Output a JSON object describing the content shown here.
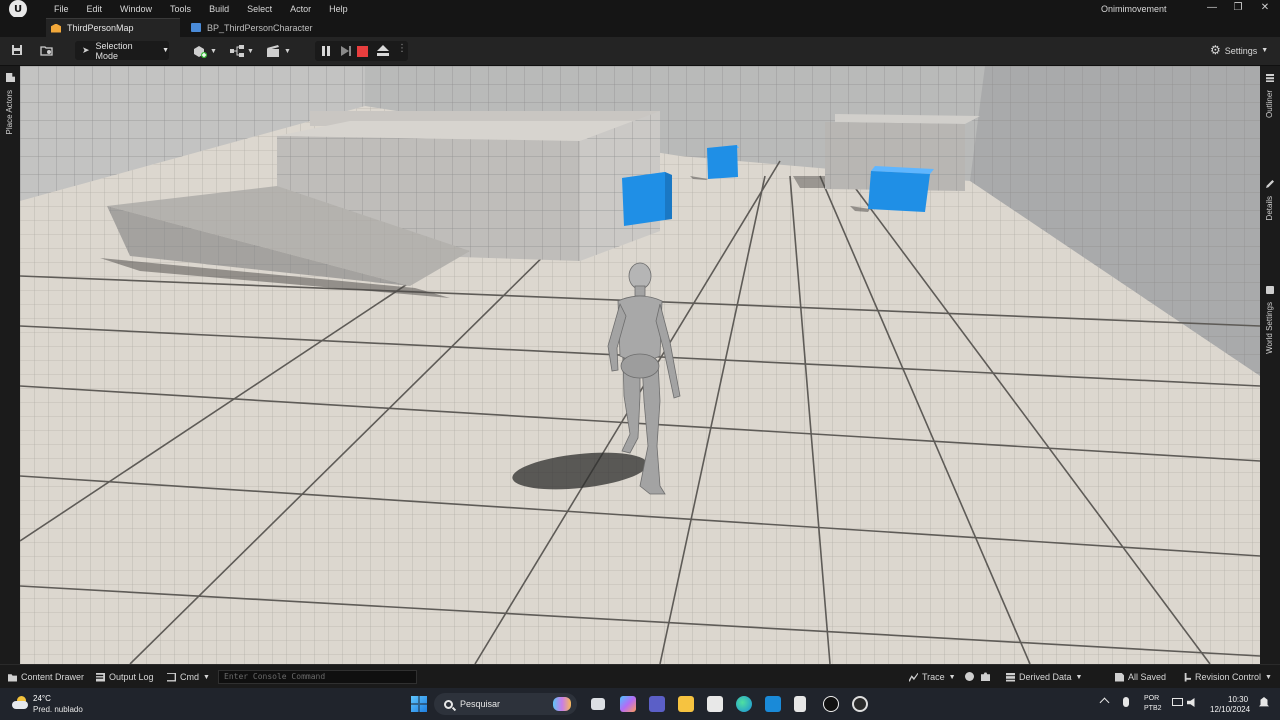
{
  "app": {
    "logo": "U",
    "menu": [
      "File",
      "Edit",
      "Window",
      "Tools",
      "Build",
      "Select",
      "Actor",
      "Help"
    ],
    "project_name": "Onimimovement",
    "window_controls": [
      "—",
      "❐",
      "✕"
    ]
  },
  "tabs": [
    {
      "label": "ThirdPersonMap",
      "active": true,
      "icon": "level-icon"
    },
    {
      "label": "BP_ThirdPersonCharacter",
      "active": false,
      "icon": "blueprint-icon"
    }
  ],
  "toolbar": {
    "selection_mode": "Selection Mode",
    "settings": "Settings",
    "icons": [
      "save-icon",
      "content-browser-icon",
      "add-actor-icon",
      "blueprint-menu-icon",
      "cinematics-icon",
      "pause-icon",
      "step-icon",
      "stop-icon",
      "eject-icon",
      "more-icon",
      "gear-icon"
    ]
  },
  "side_panels": {
    "left": "Place Actors",
    "right": [
      "Outliner",
      "Details",
      "World Settings"
    ]
  },
  "statusbar": {
    "content_drawer": "Content Drawer",
    "output_log": "Output Log",
    "cmd": "Cmd",
    "console_placeholder": "Enter Console Command",
    "trace": "Trace",
    "derived_data": "Derived Data",
    "all_saved": "All Saved",
    "revision_control": "Revision Control"
  },
  "taskbar": {
    "weather_temp": "24°C",
    "weather_desc": "Pred. nublado",
    "search": "Pesquisar",
    "lang_line1": "POR",
    "lang_line2": "PTB2",
    "time": "10:30",
    "date": "12/10/2024"
  },
  "colors": {
    "editor_bg": "#151515",
    "toolbar_bg": "#242424",
    "stop_red": "#e83e3e",
    "cube_blue": "#1f8fe6",
    "floor": "#dcd7cf",
    "taskbar_bg": "#20242c"
  }
}
